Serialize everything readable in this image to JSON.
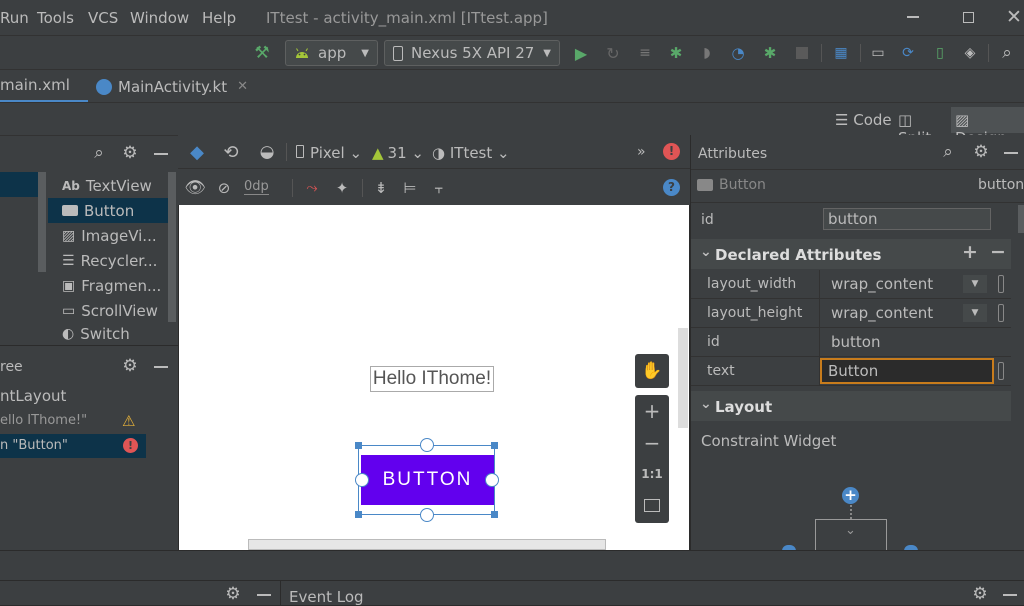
{
  "menubar": {
    "items": [
      "Run",
      "Tools",
      "VCS",
      "Window",
      "Help"
    ],
    "title": "ITtest - activity_main.xml [ITtest.app]"
  },
  "toolbar": {
    "run_config": "app",
    "device": "Nexus 5X API 27"
  },
  "tabs": [
    {
      "label": "main.xml"
    },
    {
      "label": "MainActivity.kt"
    }
  ],
  "view_modes": {
    "code": "Code",
    "split": "Split",
    "design": "Design"
  },
  "palette": {
    "items": [
      "TextView",
      "Button",
      "ImageVi...",
      "Recycler...",
      "Fragmen...",
      "ScrollView",
      "Switch"
    ]
  },
  "component_tree": {
    "header": "ree",
    "rows": [
      {
        "label": "ntLayout"
      },
      {
        "label": "ello IThome!\""
      },
      {
        "label": "n  \"Button\""
      }
    ]
  },
  "design_toolbar": {
    "device": "Pixel",
    "api": "31",
    "theme": "ITtest",
    "margin": "0dp"
  },
  "canvas": {
    "textview_text": "Hello IThome!",
    "button_text": "BUTTON",
    "zoom_reset": "1:1"
  },
  "attributes": {
    "title": "Attributes",
    "component_type": "Button",
    "component_id": "button",
    "id_label": "id",
    "id_value": "button",
    "declared_header": "Declared Attributes",
    "declared": [
      {
        "name": "layout_width",
        "value": "wrap_content"
      },
      {
        "name": "layout_height",
        "value": "wrap_content"
      },
      {
        "name": "id",
        "value": "button"
      },
      {
        "name": "text",
        "value": "Button"
      }
    ],
    "layout_header": "Layout",
    "constraint_widget": "Constraint Widget"
  },
  "bottom": {
    "event_log": "Event Log"
  },
  "colors": {
    "accent": "#4a88c7",
    "button_purple": "#6200ee",
    "android_green": "#a4c639",
    "run_green": "#59a869",
    "error_red": "#e05555",
    "warning_yellow": "#e8b339"
  }
}
